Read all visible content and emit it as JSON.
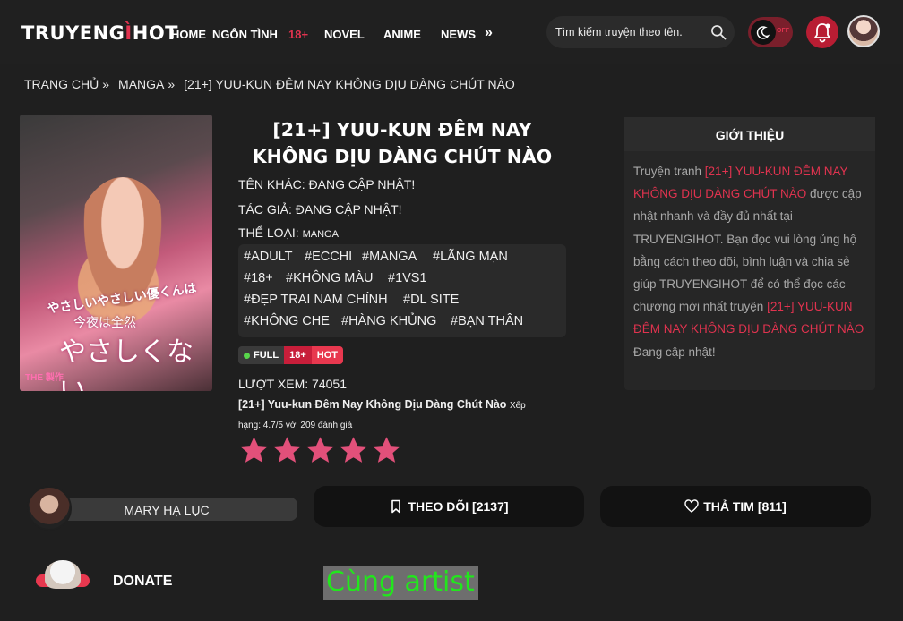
{
  "header": {
    "logo": {
      "part1": "TRUYENG",
      "accent": "Ì",
      "part2": "HOT"
    },
    "nav": [
      {
        "label": "HOME"
      },
      {
        "label": "NGÔN TÌNH"
      },
      {
        "label": "18+",
        "highlight": true
      },
      {
        "label": "NOVEL"
      },
      {
        "label": "ANIME"
      },
      {
        "label": "NEWS"
      }
    ],
    "nav_more": "»",
    "search_placeholder": "Tìm kiếm truyện theo tên.",
    "theme_toggle": "OFF"
  },
  "breadcrumb": [
    "TRANG CHỦ",
    "»",
    "MANGA",
    "»",
    "[21+] YUU-KUN ĐÊM NAY KHÔNG DỊU DÀNG CHÚT NÀO"
  ],
  "cover": {
    "jp_line1": "やさしいやさしい優くんは",
    "jp_line2": "今夜は全然",
    "jp_line3": "やさしくない",
    "badge": "THE 製作"
  },
  "manga": {
    "title": "[21+] YUU-KUN ĐÊM NAY KHÔNG DỊU DÀNG CHÚT NÀO",
    "other_name": "TÊN KHÁC: ĐANG CẬP NHẬT!",
    "author": "TÁC GIẢ: ĐANG CẬP NHẬT!",
    "genre_label": "THỂ LOẠI:",
    "genre_value": "MANGA",
    "tags": [
      "#ADULT",
      "#ECCHI",
      "#MANGA",
      "#LÃNG MẠN",
      "#18+",
      "#KHÔNG MÀU",
      "#1VS1",
      "#ĐẸP TRAI NAM CHÍNH",
      "#DL SITE",
      "#KHÔNG CHE",
      "#HÀNG KHỦNG",
      "#BẠN THÂN"
    ],
    "status": {
      "full": "FULL",
      "age": "18+",
      "hot": "HOT"
    },
    "views": "LƯỢT XEM: 74051",
    "rating_title": "[21+] Yuu-kun Đêm Nay Không Dịu Dàng Chút Nào",
    "rating_word": "Xếp",
    "rating_detail": "hạng: 4.7/5 với 209 đánh giá",
    "rating_value": 4.7,
    "rating_max": 5,
    "star_color": "#e2507a"
  },
  "intro": {
    "heading": "GIỚI THIỆU",
    "p1_a": "Truyện tranh ",
    "p1_title": "[21+] YUU-KUN ĐÊM NAY KHÔNG DỊU DÀNG CHÚT NÀO",
    "p1_b": " được cập nhật nhanh và đầy đủ nhất tại TRUYENGIHOT. Bạn đọc vui lòng ủng hộ bằng cách theo dõi, bình luận và chia sẻ giúp TRUYENGIHOT để có thể đọc các chương mới nhất truyện ",
    "p1_title2": "[21+] YUU-KUN ĐÊM NAY KHÔNG DỊU DÀNG CHÚT NÀO",
    "p2": "Đang cập nhật!"
  },
  "actions": {
    "uploader": "MARY HẠ LỤC",
    "follow": "THEO DÕI [2137]",
    "like": "THẢ TIM [811]",
    "donate": "DONATE",
    "same_artist": "Cùng artist"
  },
  "colors": {
    "accent": "#e0334f",
    "background": "#1f1f1f",
    "same_artist_text": "#22e61d"
  }
}
